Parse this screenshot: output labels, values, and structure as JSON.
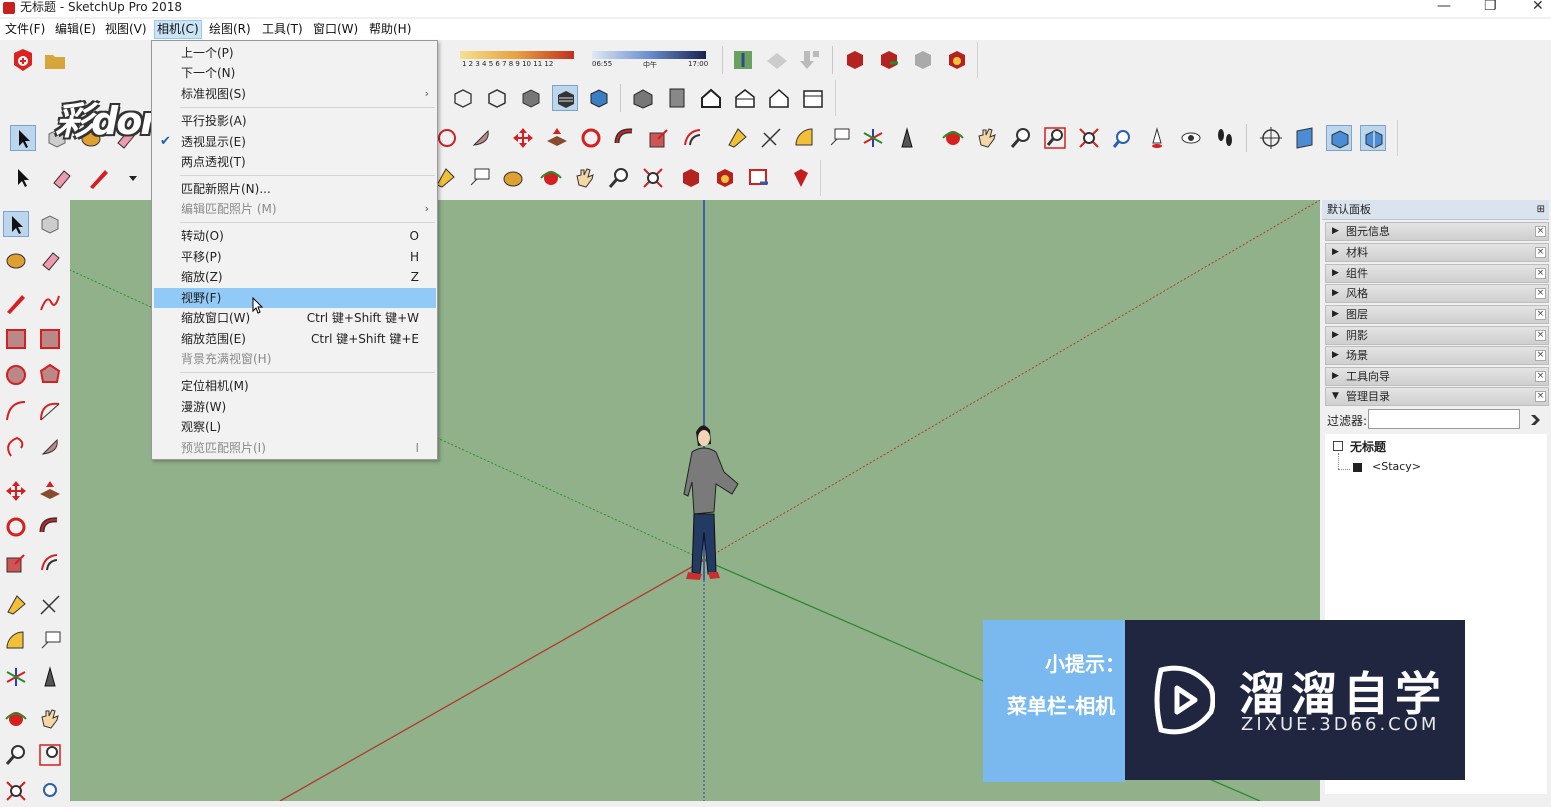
{
  "window": {
    "title": "无标题 - SketchUp Pro 2018",
    "minimize": "—",
    "maximize": "❐",
    "close": "✕"
  },
  "menubar": [
    {
      "label": "文件(F)"
    },
    {
      "label": "编辑(E)"
    },
    {
      "label": "视图(V)"
    },
    {
      "label": "相机(C)",
      "active": true
    },
    {
      "label": "绘图(R)"
    },
    {
      "label": "工具(T)"
    },
    {
      "label": "窗口(W)"
    },
    {
      "label": "帮助(H)"
    }
  ],
  "watermark": "彩dong视频",
  "shadow_bar": {
    "months": "1 2 3 4 5 6 7 8 9 10 11 12",
    "time_start": "06:55",
    "time_mid": "中午",
    "time_end": "17:00"
  },
  "camera_menu": {
    "items": [
      {
        "label": "上一个(P)",
        "shortcut": "",
        "type": "item"
      },
      {
        "label": "下一个(N)",
        "shortcut": "",
        "type": "item"
      },
      {
        "label": "标准视图(S)",
        "shortcut": "",
        "type": "submenu"
      },
      {
        "type": "separator"
      },
      {
        "label": "平行投影(A)",
        "shortcut": "",
        "type": "item"
      },
      {
        "label": "透视显示(E)",
        "shortcut": "",
        "type": "item",
        "checked": true
      },
      {
        "label": "两点透视(T)",
        "shortcut": "",
        "type": "item"
      },
      {
        "type": "separator"
      },
      {
        "label": "匹配新照片(N)...",
        "shortcut": "",
        "type": "item"
      },
      {
        "label": "编辑匹配照片 (M)",
        "shortcut": "",
        "type": "submenu",
        "disabled": true
      },
      {
        "type": "separator"
      },
      {
        "label": "转动(O)",
        "shortcut": "O",
        "type": "item"
      },
      {
        "label": "平移(P)",
        "shortcut": "H",
        "type": "item"
      },
      {
        "label": "缩放(Z)",
        "shortcut": "Z",
        "type": "item"
      },
      {
        "label": "视野(F)",
        "shortcut": "",
        "type": "item",
        "hover": true
      },
      {
        "label": "缩放窗口(W)",
        "shortcut": "Ctrl 键+Shift 键+W",
        "type": "item"
      },
      {
        "label": "缩放范围(E)",
        "shortcut": "Ctrl 键+Shift 键+E",
        "type": "item"
      },
      {
        "label": "背景充满视窗(H)",
        "shortcut": "",
        "type": "item",
        "disabled": true
      },
      {
        "type": "separator"
      },
      {
        "label": "定位相机(M)",
        "shortcut": "",
        "type": "item"
      },
      {
        "label": "漫游(W)",
        "shortcut": "",
        "type": "item"
      },
      {
        "label": "观察(L)",
        "shortcut": "",
        "type": "item"
      },
      {
        "label": "预览匹配照片(I)",
        "shortcut": "I",
        "type": "item",
        "disabled": true
      }
    ]
  },
  "default_tray": {
    "title": "默认面板",
    "pin": "⊞",
    "panels": [
      {
        "label": "图元信息",
        "expanded": false
      },
      {
        "label": "材料",
        "expanded": false
      },
      {
        "label": "组件",
        "expanded": false
      },
      {
        "label": "风格",
        "expanded": false
      },
      {
        "label": "图层",
        "expanded": false
      },
      {
        "label": "阴影",
        "expanded": false
      },
      {
        "label": "场景",
        "expanded": false
      },
      {
        "label": "工具向导",
        "expanded": false
      },
      {
        "label": "管理目录",
        "expanded": true
      }
    ],
    "filter_label": "过滤器:",
    "filter_value": "",
    "outliner": {
      "root": "无标题",
      "child": "<Stacy>"
    }
  },
  "tip": {
    "line1": "小提示：",
    "line2": "菜单栏-相机"
  },
  "logo": {
    "name": "溜溜自学",
    "url_text": "ZIXUE.3D66.COM"
  },
  "colors": {
    "viewport": "#91b18a",
    "menu_hover": "#91c9f7",
    "tip_bg": "#7ab9f0",
    "logo_bg": "#20263f",
    "axis_red": "#b03a2e",
    "axis_green": "#2e8b2e",
    "axis_blue": "#2a3fb0"
  }
}
